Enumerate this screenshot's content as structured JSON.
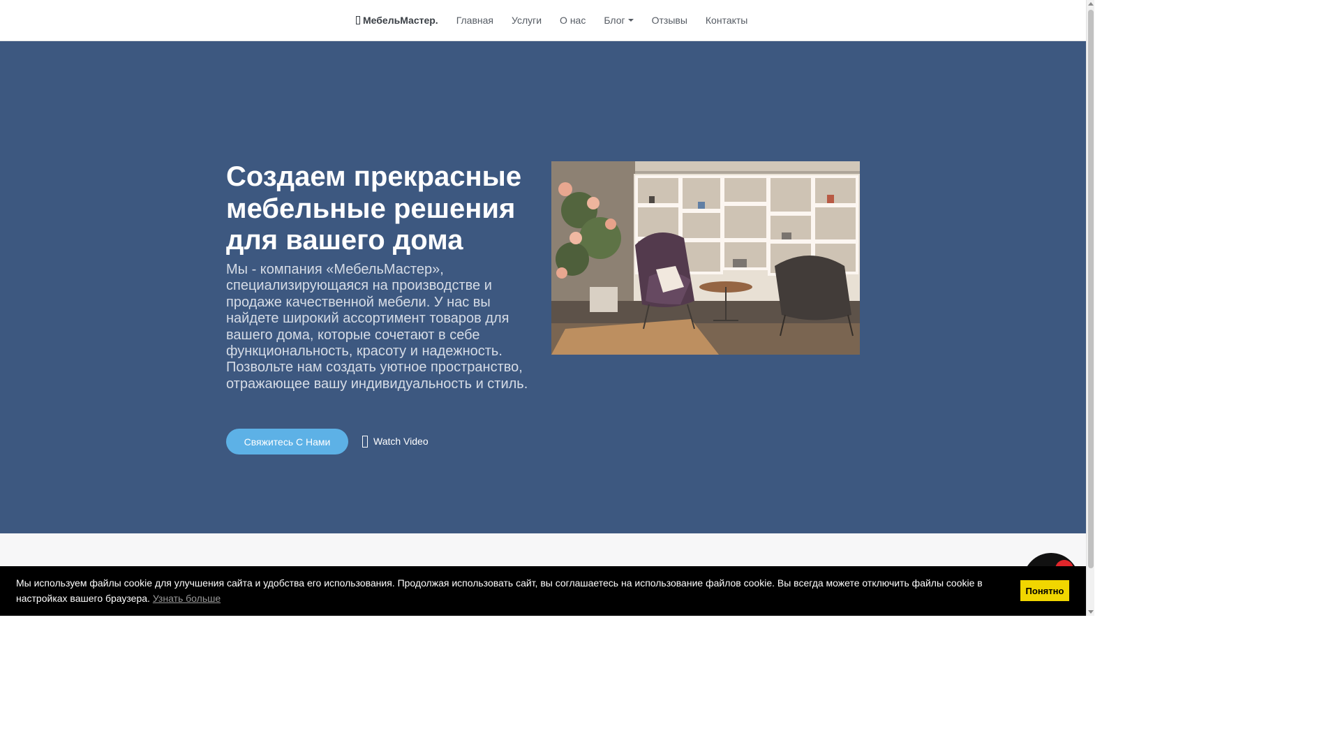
{
  "navbar": {
    "brand": "МебельМастер.",
    "links": [
      "Главная",
      "Услуги",
      "О нас",
      "Блог",
      "Отзывы",
      "Контакты"
    ]
  },
  "hero": {
    "title": "Создаем прекрасные мебельные решения для вашего дома",
    "text": "Мы - компания «МебельМастер», специализирующаяся на производстве и продаже качественной мебели. У нас вы найдете широкий ассортимент товаров для вашего дома, которые сочетают в себе функциональность, красоту и надежность. Позвольте нам создать уютное пространство, отражающее вашу индивидуальность и стиль.",
    "contact_button": "Свяжитесь С Нами",
    "watch_video": "Watch Video"
  },
  "chat": {
    "badge_count": "0"
  },
  "cookie": {
    "text": "Мы используем файлы cookie для улучшения сайта и удобства его использования. Продолжая использовать сайт, вы соглашаетесь на использование файлов cookie. Вы всегда можете отключить файлы cookie в настройках вашего браузера.",
    "link": "Узнать больше",
    "button": "Понятно"
  },
  "colors": {
    "hero_bg": "#3d5880",
    "button_blue": "#5db1e6",
    "cookie_button": "#f1d600",
    "badge_red": "#e0262b"
  }
}
